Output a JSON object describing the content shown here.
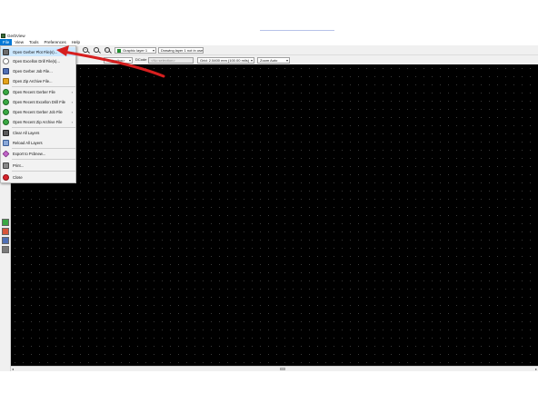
{
  "window": {
    "title": "GerbView"
  },
  "menubar": {
    "items": [
      "File",
      "View",
      "Tools",
      "Preferences",
      "Help"
    ]
  },
  "toolbar": {
    "layer_select": "Graphic layer 1",
    "drawing_layer": "Drawing layer 1 not in use",
    "selection_combo": "<selection>",
    "dcode_label": "DCode",
    "dcode_combo": "<No selection>",
    "grid_combo": "Grid: 2.5400 mm (100.00 mils)",
    "zoom_combo": "Zoom Auto"
  },
  "file_menu": {
    "items": [
      {
        "label": "Open Gerber Plot File(s)...",
        "icon": "gerber-plot-icon",
        "submenu": false
      },
      {
        "label": "Open Excellon Drill File(s)...",
        "icon": "drill-file-icon",
        "submenu": false
      },
      {
        "label": "Open Gerber Job File...",
        "icon": "gerber-job-icon",
        "submenu": false
      },
      {
        "label": "Open Zip Archive File...",
        "icon": "zip-archive-icon",
        "submenu": false
      },
      {
        "label": "Open Recent Gerber File",
        "icon": "recent-gerber-icon",
        "submenu": true
      },
      {
        "label": "Open Recent Excellon Drill File",
        "icon": "recent-drill-icon",
        "submenu": true
      },
      {
        "label": "Open Recent Gerber Job File",
        "icon": "recent-job-icon",
        "submenu": true
      },
      {
        "label": "Open Recent Zip Archive File",
        "icon": "recent-zip-icon",
        "submenu": true
      },
      {
        "label": "Clear All Layers",
        "icon": "clear-layers-icon",
        "submenu": false
      },
      {
        "label": "Reload All Layers",
        "icon": "reload-layers-icon",
        "submenu": false
      },
      {
        "label": "Export to Pcbnew...",
        "icon": "export-pcbnew-icon",
        "submenu": false
      },
      {
        "label": "Print...",
        "icon": "print-icon",
        "submenu": false
      },
      {
        "label": "Close",
        "icon": "close-icon",
        "submenu": false
      }
    ]
  },
  "colors": {
    "annotation_arrow": "#d61f1f",
    "canvas": "#000000",
    "menu_highlight": "#0078d7",
    "hover": "#cce8ff"
  }
}
